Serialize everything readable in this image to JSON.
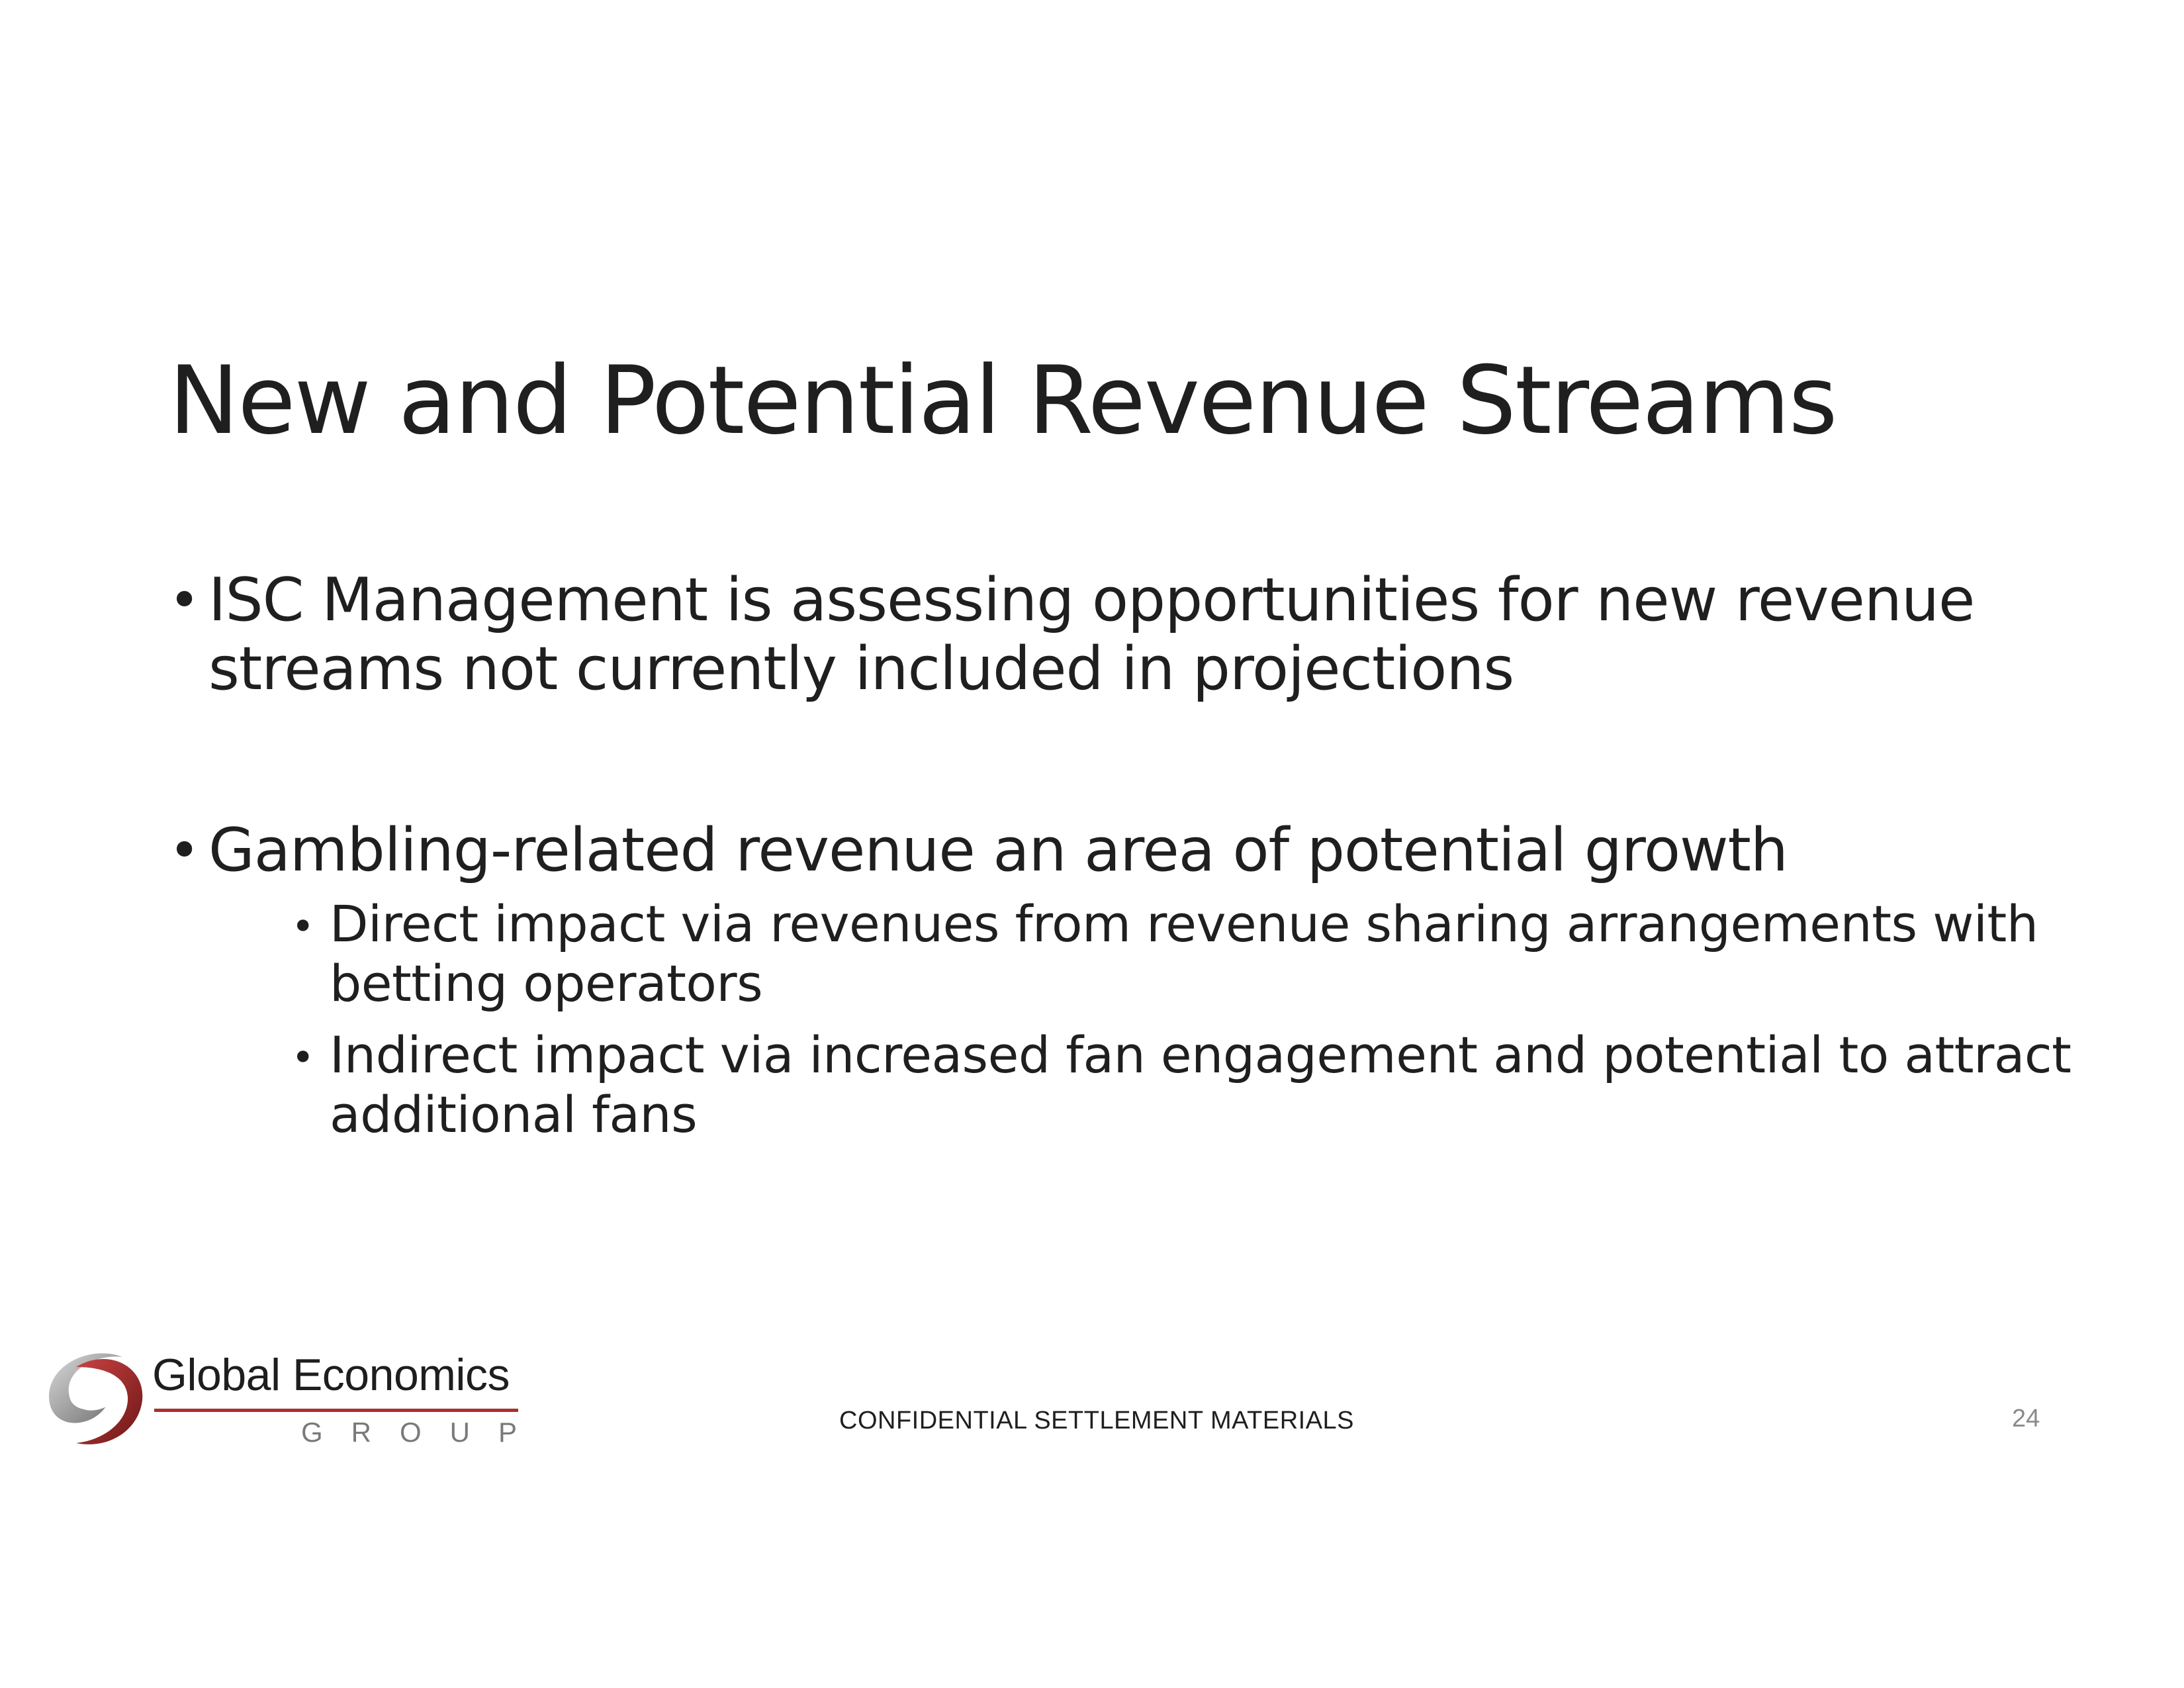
{
  "slide": {
    "title": "New and Potential Revenue Streams",
    "bullets": [
      {
        "text": "ISC Management is assessing opportunities for new revenue streams not currently included in projections"
      },
      {
        "text": "Gambling-related revenue an area of potential growth",
        "sub": [
          "Direct impact via revenues from revenue sharing arrangements with betting operators",
          "Indirect impact via increased fan engagement and potential to attract additional fans"
        ]
      }
    ],
    "bullet_glyph": "•"
  },
  "footer": {
    "logo_name": "Global Economics",
    "logo_group": "GROUP",
    "confidential": "CONFIDENTIAL SETTLEMENT MATERIALS",
    "page_number": "24"
  },
  "colors": {
    "text": "#1f1f1f",
    "logo_red": "#a8302f",
    "logo_gray": "#7a7a7a",
    "page_number": "#8a8a8a"
  }
}
